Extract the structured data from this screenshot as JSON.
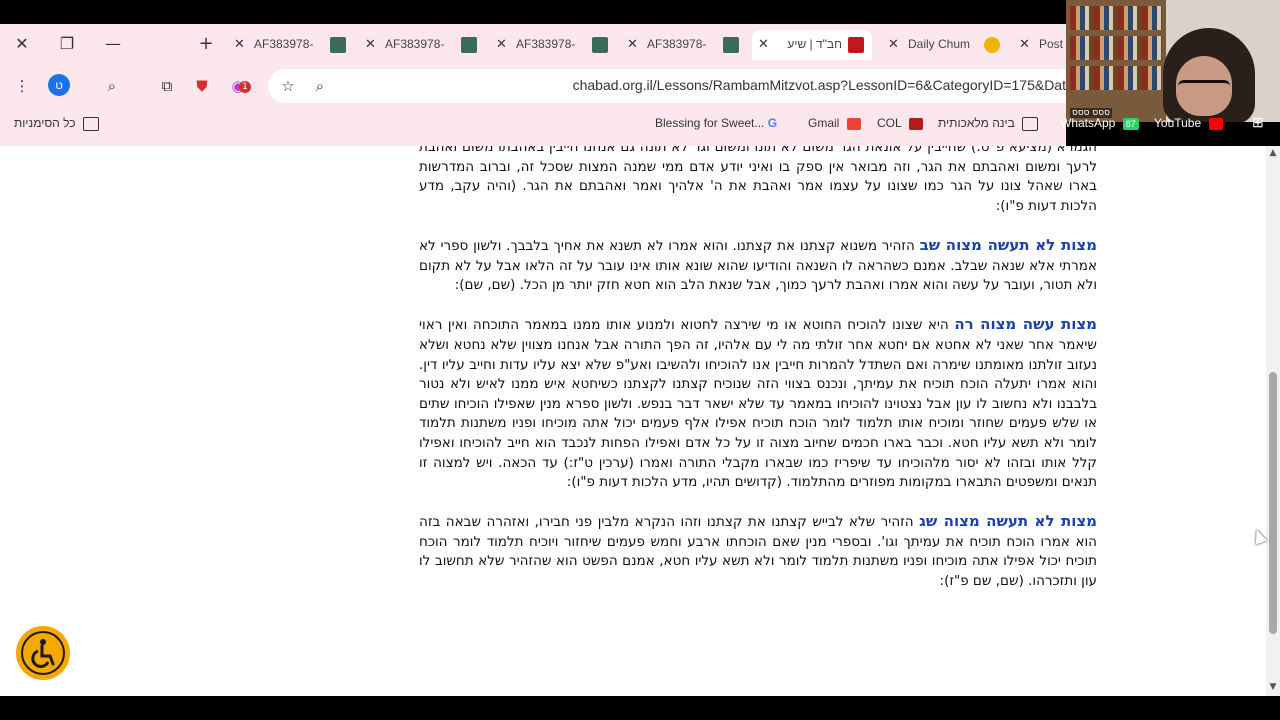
{
  "browser": {
    "tabs": [
      {
        "title": "AF383978-",
        "active": false
      },
      {
        "title": "AF383978-",
        "active": false
      },
      {
        "title": "AF383978-",
        "active": false
      },
      {
        "title": "AF383978-",
        "active": false
      },
      {
        "title": "חב\"ד | שיע",
        "active": true
      },
      {
        "title": "Daily Chum",
        "active": false
      },
      {
        "title": "Post",
        "active": false
      }
    ],
    "url": "chabad.org.il/Lessons/RambamMitzvot.asp?LessonID=6&CategoryID=175&Dat",
    "profile_initial": "ט",
    "extension_badge": "1",
    "bookmarks": {
      "all_bookmarks": "כל הסימניות",
      "items": [
        {
          "label": "Blessing for Sweet..."
        },
        {
          "label": "Gmail"
        },
        {
          "label": "COL"
        },
        {
          "label": "בינה מלאכותית"
        },
        {
          "label": "WhatsApp"
        },
        {
          "label": "YouTube"
        }
      ],
      "whatsapp_badge": "87"
    }
  },
  "article": {
    "p1": "הגמרא (מציעא פ\"ט:) שחייבין על אונאת הגר משום לא תונו ומשום וגר לא תונה גם אנחנו חייבין באהבתו משום ואהבת לרעך ומשום ואהבתם את הגר, וזה מבואר אין ספק בו ואיני יודע אדם ממי שמנה המצות שסכל זה, וברוב המדרשות בארו שאהל צונו על הגר כמו שצונו על עצמו אמר ואהבת את ה' אלהיך ואמר ואהבתם את הגר. (והיה עקב, מדע הלכות דעות פ\"ו):",
    "s2_heading": "מצות לא תעשה מצוה שב",
    "s2_body": "הזהיר משנוא קצתנו את קצתנו. והוא אמרו לא תשנא את אחיך בלבבך. ולשון ספרי לא אמרתי אלא שנאה שבלב. אמנם כשהראה לו השנאה והודיעו שהוא שונא אותו אינו עובר על זה הלאו אבל על לא תקום ולא תטור, ועובר על עשה והוא אמרו ואהבת לרעך כמוך, אבל שנאת הלב הוא חטא חזק יותר מן הכל. (שם, שם):",
    "s3_heading": "מצות עשה מצוה רה",
    "s3_body": "היא שצונו להוכיח החוטא או מי שירצה לחטוא ולמנוע אותו ממנו במאמר התוכחה ואין ראוי שיאמר אחר שאני לא אחטא אם יחטא אחר זולתי מה לי עם אלהיו, זה הפך התורה אבל אנחנו מצווין שלא נחטא ושלא נעזוב זולתנו מאומתנו שימרה ואם השתדל להמרות חייבין אנו להוכיחו ולהשיבו ואע\"פ שלא יצא עליו עדות וחייב עליו דין. והוא אמרו יתעלה הוכח תוכיח את עמיתך, ונכנס בצווי הזה שנוכיח קצתנו לקצתנו כשיחטא איש ממנו לאיש ולא נטור בלבבנו ולא נחשוב לו עון אבל נצטוינו להוכיחו במאמר עד שלא ישאר דבר בנפש. ולשון ספרא מנין שאפילו הוכיחו שתים או שלש פעמים שחוזר ומוכיח אותו תלמוד לומר הוכח תוכיח אפילו אלף פעמים יכול אתה מוכיחו ופניו משתנות תלמוד לומר ולא תשא עליו חטא. וכבר בארו חכמים שחיוב מצוה זו על כל אדם ואפילו הפחות לנכבד הוא חייב להוכיחו ואפילו קלל אותו ובזהו לא יסור מלהוכיחו עד שיפריז כמו שבארו מקבלי התורה ואמרו (ערכין ט\"ז:) עד הכאה. ויש למצוה זו תנאים ומשפטים התבארו במקומות מפוזרים מהתלמוד. (קדושים תהיו, מדע הלכות דעות פ\"ו):",
    "s4_heading": "מצות לא תעשה מצוה שג",
    "s4_body": "הזהיר שלא לבייש קצתנו את קצתנו וזהו הנקרא מלבין פני חבירו, ואזהרה שבאה בזה הוא אמרו הוכח תוכיח את עמיתך וגו'. ובספרי מנין שאם הוכחתו ארבע וחמש פעמים שיחזור ויוכיח תלמוד לומר הוכח תוכיח יכול אפילו אתה מוכיחו ופניו משתנות תלמוד לומר ולא תשא עליו חטא, אמנם הפשט הוא שהזהיר שלא תחשוב לו עון ותזכרהו. (שם, שם פ\"ז):"
  },
  "video": {
    "name_tag": "ססס ססס"
  },
  "colors": {
    "heading": "#1a3fb0",
    "chrome": "#fce8ec",
    "a11y": "#f5a800"
  }
}
